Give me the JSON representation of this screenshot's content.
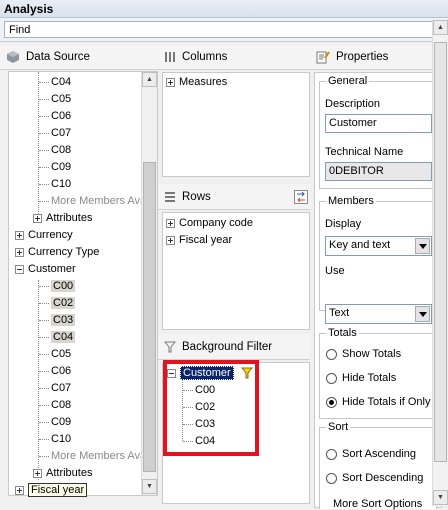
{
  "window": {
    "title": "Analysis"
  },
  "find": {
    "value": "Find"
  },
  "data_source": {
    "title": "Data Source",
    "rows_top": [
      "C04",
      "C05",
      "C06",
      "C07",
      "C08",
      "C09",
      "C10"
    ],
    "more_members": "More Members Ava",
    "attributes": "Attributes",
    "currency": "Currency",
    "currency_type": "Currency Type",
    "customer": "Customer",
    "customer_children_selected": [
      "C00",
      "C02",
      "C03",
      "C04"
    ],
    "customer_children": [
      "C05",
      "C06",
      "C07",
      "C08",
      "C09",
      "C10"
    ],
    "more_members_2": "More Members Ava",
    "attributes_2": "Attributes",
    "fiscal_year": "Fiscal year"
  },
  "columns": {
    "title": "Columns",
    "items": [
      "Measures"
    ]
  },
  "rows": {
    "title": "Rows",
    "items": [
      "Company code",
      "Fiscal year"
    ]
  },
  "background_filter": {
    "title": "Background Filter",
    "root": "Customer",
    "children": [
      "C00",
      "C02",
      "C03",
      "C04"
    ],
    "highlight_color": "#e0141e"
  },
  "properties": {
    "title": "Properties",
    "general": {
      "title": "General",
      "description_label": "Description",
      "description_value": "Customer",
      "technical_label": "Technical Name",
      "technical_value": "0DEBITOR"
    },
    "members": {
      "title": "Members",
      "display_label": "Display",
      "display_value": "Key and text",
      "use_label": "Use",
      "use_value": "Text"
    },
    "totals": {
      "title": "Totals",
      "options": [
        "Show Totals",
        "Hide Totals",
        "Hide Totals if Only C"
      ],
      "selected_index": 2
    },
    "sort": {
      "title": "Sort",
      "options": [
        "Sort Ascending",
        "Sort Descending"
      ],
      "more": "More Sort Options"
    }
  }
}
